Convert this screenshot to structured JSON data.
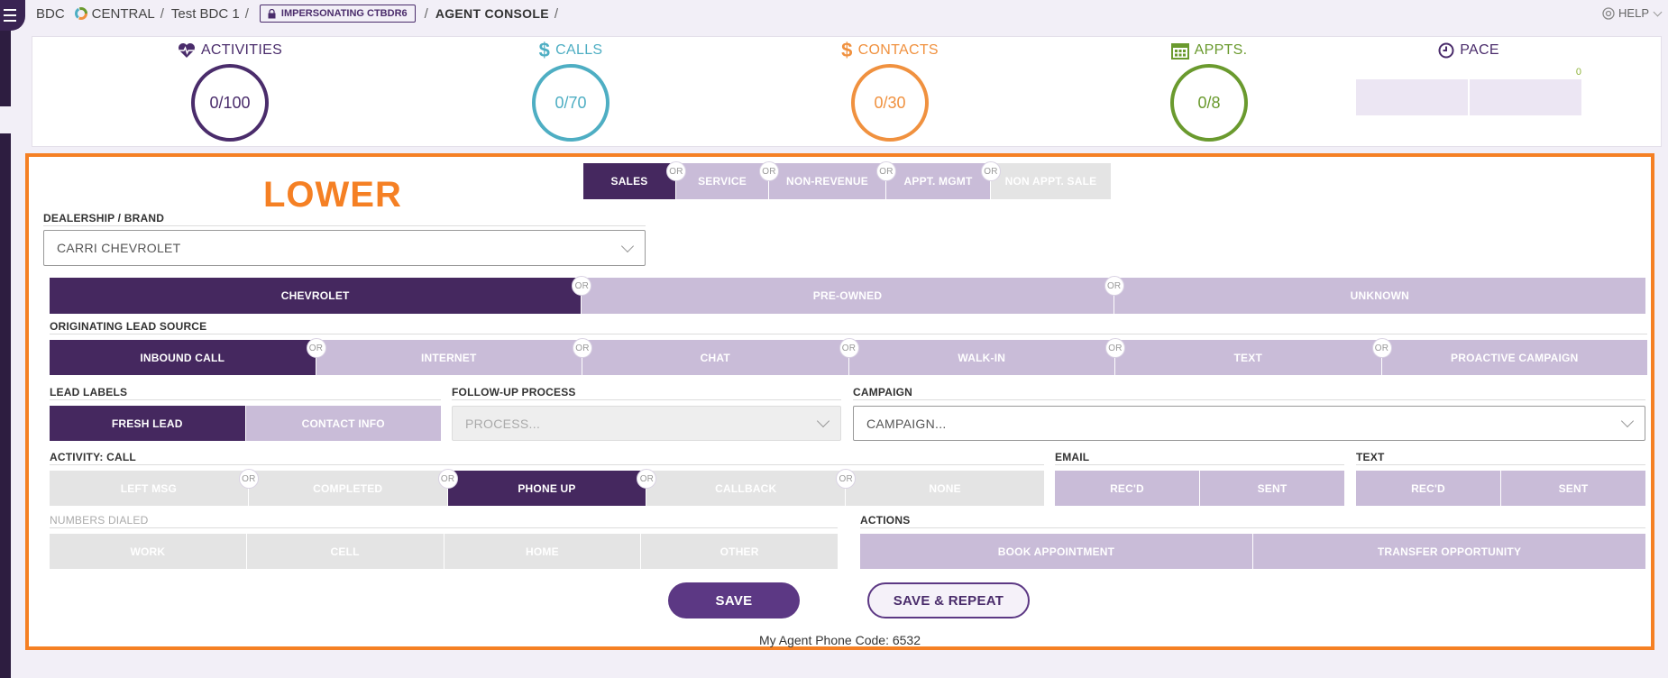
{
  "topbar": {
    "brand_left": "BDC",
    "brand_right": "CENTRAL",
    "crumb_account": "Test BDC 1",
    "impersonating": "IMPERSONATING CTBDR6",
    "page": "AGENT CONSOLE",
    "help": "HELP"
  },
  "stats": {
    "activities": {
      "label": "ACTIVITIES",
      "value": "0/100",
      "color": "#4a2c6b"
    },
    "calls": {
      "label": "CALLS",
      "value": "0/70",
      "color": "#4eaec3"
    },
    "contacts": {
      "label": "CONTACTS",
      "value": "0/30",
      "color": "#f0913f"
    },
    "appts": {
      "label": "APPTS.",
      "value": "0/8",
      "color": "#6a9a2e"
    },
    "pace": {
      "label": "PACE",
      "value": "0"
    }
  },
  "lower_label": "LOWER",
  "dept_tabs": [
    {
      "label": "SALES",
      "selected": true
    },
    {
      "label": "SERVICE",
      "selected": false
    },
    {
      "label": "NON-REVENUE",
      "selected": false
    },
    {
      "label": "APPT. MGMT",
      "selected": false
    },
    {
      "label": "NON APPT. SALE",
      "selected": false
    }
  ],
  "or_text": "or",
  "dealership": {
    "label": "DEALERSHIP / BRAND",
    "value": "CARRI CHEVROLET"
  },
  "brand_options": [
    {
      "label": "CHEVROLET",
      "selected": true
    },
    {
      "label": "PRE-OWNED",
      "selected": false
    },
    {
      "label": "UNKNOWN",
      "selected": false
    }
  ],
  "lead_source": {
    "label": "ORIGINATING LEAD SOURCE",
    "options": [
      "INBOUND CALL",
      "INTERNET",
      "CHAT",
      "WALK-IN",
      "TEXT",
      "PROACTIVE CAMPAIGN"
    ]
  },
  "lead_labels": {
    "label": "LEAD LABELS",
    "options": [
      "FRESH LEAD",
      "CONTACT INFO"
    ]
  },
  "follow_up": {
    "label": "FOLLOW-UP PROCESS",
    "placeholder": "PROCESS..."
  },
  "campaign": {
    "label": "CAMPAIGN",
    "placeholder": "CAMPAIGN..."
  },
  "activity": {
    "label": "ACTIVITY: CALL",
    "options": [
      "LEFT MSG",
      "COMPLETED",
      "PHONE UP",
      "CALLBACK",
      "NONE"
    ]
  },
  "email": {
    "label": "EMAIL",
    "options": [
      "REC'D",
      "SENT"
    ]
  },
  "text": {
    "label": "TEXT",
    "options": [
      "REC'D",
      "SENT"
    ]
  },
  "numbers_dialed": {
    "label": "NUMBERS DIALED",
    "options": [
      "WORK",
      "CELL",
      "HOME",
      "OTHER"
    ]
  },
  "actions": {
    "label": "ACTIONS",
    "options": [
      "BOOK APPOINTMENT",
      "TRANSFER OPPORTUNITY"
    ]
  },
  "save_label": "SAVE",
  "save_repeat_label": "SAVE & REPEAT",
  "phone_code_label": "My Agent Phone Code:",
  "phone_code_value": "6532",
  "colors": {
    "accent": "#45285f",
    "orange": "#f58024",
    "inactive": "#c9bcd8"
  }
}
